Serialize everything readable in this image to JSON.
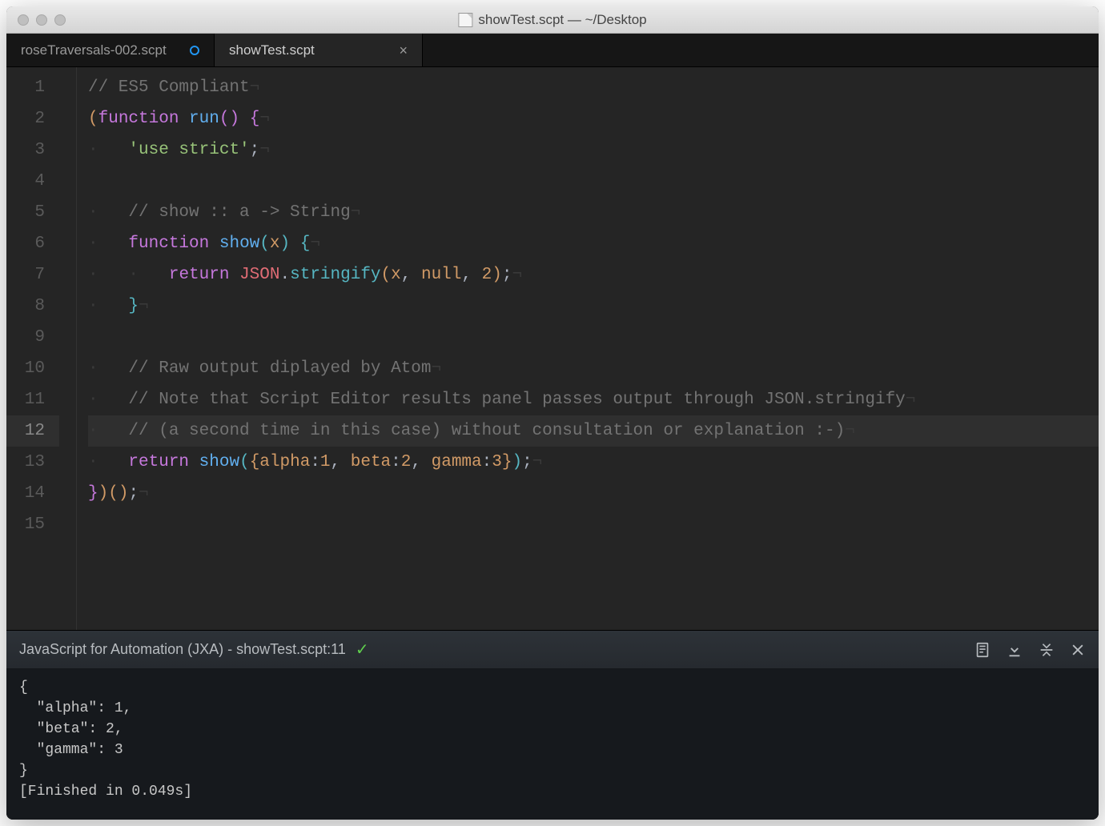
{
  "window": {
    "title": "showTest.scpt — ~/Desktop"
  },
  "tabs": [
    {
      "label": "roseTraversals-002.scpt",
      "modified": true,
      "active": false
    },
    {
      "label": "showTest.scpt",
      "modified": false,
      "active": true
    }
  ],
  "editor": {
    "highlighted_line": 12,
    "line_count": 15,
    "code_lines": [
      {
        "n": 1,
        "indent": 0,
        "tokens": [
          [
            "comment",
            "// ES5 Compliant"
          ]
        ]
      },
      {
        "n": 2,
        "indent": 0,
        "tokens": [
          [
            "p1",
            "("
          ],
          [
            "keyword",
            "function"
          ],
          [
            "punct",
            " "
          ],
          [
            "fn-name",
            "run"
          ],
          [
            "p2",
            "("
          ],
          [
            "p2",
            ")"
          ],
          [
            "punct",
            " "
          ],
          [
            "p2",
            "{"
          ]
        ]
      },
      {
        "n": 3,
        "indent": 1,
        "tokens": [
          [
            "string",
            "'use strict'"
          ],
          [
            "punct",
            ";"
          ]
        ]
      },
      {
        "n": 4,
        "indent": 0,
        "tokens": []
      },
      {
        "n": 5,
        "indent": 1,
        "tokens": [
          [
            "comment",
            "// show :: a -> String"
          ]
        ]
      },
      {
        "n": 6,
        "indent": 1,
        "tokens": [
          [
            "keyword",
            "function"
          ],
          [
            "punct",
            " "
          ],
          [
            "fn-name",
            "show"
          ],
          [
            "p3",
            "("
          ],
          [
            "prop",
            "x"
          ],
          [
            "p3",
            ")"
          ],
          [
            "punct",
            " "
          ],
          [
            "p3",
            "{"
          ]
        ]
      },
      {
        "n": 7,
        "indent": 2,
        "tokens": [
          [
            "keyword",
            "return"
          ],
          [
            "punct",
            " "
          ],
          [
            "var",
            "JSON"
          ],
          [
            "punct",
            "."
          ],
          [
            "method",
            "stringify"
          ],
          [
            "p1",
            "("
          ],
          [
            "prop",
            "x"
          ],
          [
            "punct",
            ", "
          ],
          [
            "prop",
            "null"
          ],
          [
            "punct",
            ", "
          ],
          [
            "number",
            "2"
          ],
          [
            "p1",
            ")"
          ],
          [
            "punct",
            ";"
          ]
        ]
      },
      {
        "n": 8,
        "indent": 1,
        "tokens": [
          [
            "p3",
            "}"
          ]
        ]
      },
      {
        "n": 9,
        "indent": 0,
        "tokens": []
      },
      {
        "n": 10,
        "indent": 1,
        "tokens": [
          [
            "comment",
            "// Raw output diplayed by Atom"
          ]
        ]
      },
      {
        "n": 11,
        "indent": 1,
        "tokens": [
          [
            "comment",
            "// Note that Script Editor results panel passes output through JSON.stringify"
          ]
        ]
      },
      {
        "n": 12,
        "indent": 1,
        "tokens": [
          [
            "comment",
            "// (a second time in this case) without consultation or explanation :-)"
          ]
        ]
      },
      {
        "n": 13,
        "indent": 1,
        "tokens": [
          [
            "keyword",
            "return"
          ],
          [
            "punct",
            " "
          ],
          [
            "fn-name",
            "show"
          ],
          [
            "p3",
            "("
          ],
          [
            "p1",
            "{"
          ],
          [
            "prop",
            "alpha"
          ],
          [
            "punct",
            ":"
          ],
          [
            "number",
            "1"
          ],
          [
            "punct",
            ", "
          ],
          [
            "prop",
            "beta"
          ],
          [
            "punct",
            ":"
          ],
          [
            "number",
            "2"
          ],
          [
            "punct",
            ", "
          ],
          [
            "prop",
            "gamma"
          ],
          [
            "punct",
            ":"
          ],
          [
            "number",
            "3"
          ],
          [
            "p1",
            "}"
          ],
          [
            "p3",
            ")"
          ],
          [
            "punct",
            ";"
          ]
        ]
      },
      {
        "n": 14,
        "indent": 0,
        "tokens": [
          [
            "p2",
            "}"
          ],
          [
            "p1",
            ")"
          ],
          [
            "p1",
            "("
          ],
          [
            "p1",
            ")"
          ],
          [
            "punct",
            ";"
          ]
        ]
      },
      {
        "n": 15,
        "indent": 0,
        "tokens": []
      }
    ]
  },
  "output": {
    "header": "JavaScript for Automation (JXA) - showTest.scpt:11",
    "body": "{\n  \"alpha\": 1,\n  \"beta\": 2,\n  \"gamma\": 3\n}\n[Finished in 0.049s]"
  }
}
